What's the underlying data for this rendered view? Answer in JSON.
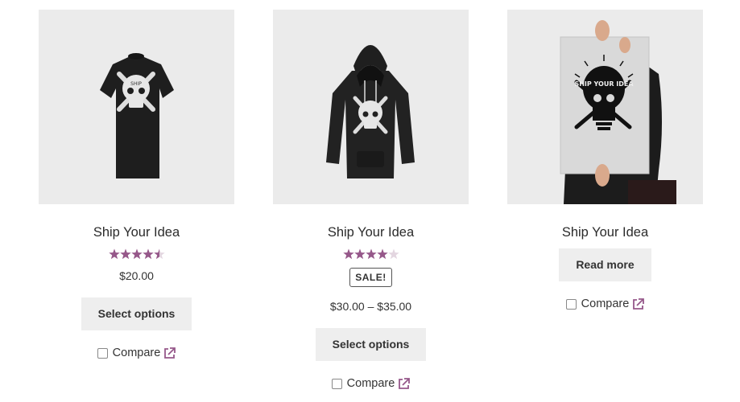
{
  "accent_color": "#96588a",
  "products": [
    {
      "image_icon": "skull-tshirt-icon",
      "title": "Ship Your Idea",
      "rating": 4.5,
      "rating_max": 5,
      "sale_badge": "",
      "price": "$20.00",
      "button_label": "Select options",
      "compare_label": "Compare",
      "compare_icon": "external-link-icon"
    },
    {
      "image_icon": "skull-hoodie-icon",
      "title": "Ship Your Idea",
      "rating": 4,
      "rating_max": 5,
      "sale_badge": "SALE!",
      "price": "$30.00 – $35.00",
      "button_label": "Select options",
      "compare_label": "Compare",
      "compare_icon": "external-link-icon"
    },
    {
      "image_icon": "poster-held-icon",
      "title": "Ship Your Idea",
      "poster_text": "SHIP YOUR IDEA",
      "button_label": "Read more",
      "compare_label": "Compare",
      "compare_icon": "external-link-icon"
    }
  ]
}
